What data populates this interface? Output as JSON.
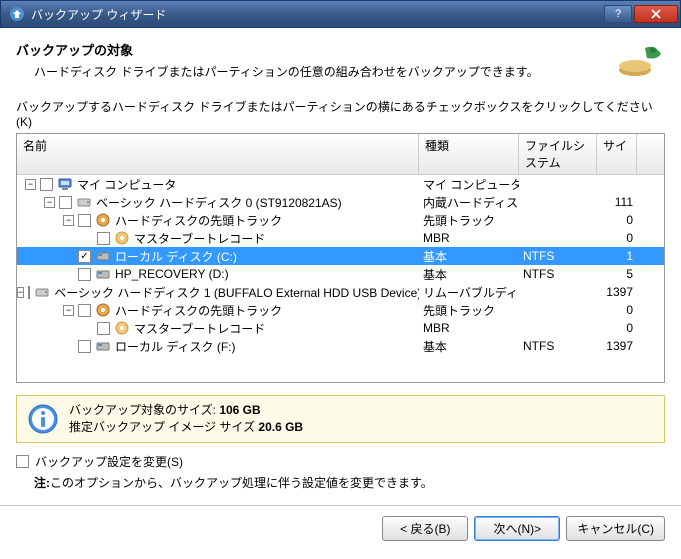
{
  "window": {
    "title": "バックアップ ウィザード"
  },
  "header": {
    "heading": "バックアップの対象",
    "sub": "ハードディスク ドライブまたはパーティションの任意の組み合わせをバックアップできます。"
  },
  "instruction": "バックアップするハードディスク ドライブまたはパーティションの横にあるチェックボックスをクリックしてください(K)",
  "columns": {
    "name": "名前",
    "type": "種類",
    "fs": "ファイルシステム",
    "size": "サイ"
  },
  "tree": [
    {
      "depth": 0,
      "expander": "-",
      "chk": false,
      "icon": "computer-icon",
      "label": "マイ コンピュータ",
      "type": "マイ コンピュータ",
      "fs": "",
      "size": ""
    },
    {
      "depth": 1,
      "expander": "-",
      "chk": false,
      "icon": "disk-icon",
      "label": "ベーシック ハードディスク 0 (ST9120821AS)",
      "type": "内蔵ハードディスク",
      "fs": "",
      "size": "111"
    },
    {
      "depth": 2,
      "expander": "-",
      "chk": false,
      "icon": "track-icon",
      "label": "ハードディスクの先頭トラック",
      "type": "先頭トラック",
      "fs": "",
      "size": "0"
    },
    {
      "depth": 3,
      "expander": "",
      "chk": false,
      "icon": "mbr-icon",
      "label": "マスターブートレコード",
      "type": "MBR",
      "fs": "",
      "size": "0"
    },
    {
      "depth": 2,
      "expander": "",
      "chk": true,
      "icon": "volume-icon",
      "label": "ローカル ディスク (C:)",
      "type": "基本",
      "fs": "NTFS",
      "size": "1",
      "selected": true
    },
    {
      "depth": 2,
      "expander": "",
      "chk": false,
      "icon": "volume-icon",
      "label": "HP_RECOVERY (D:)",
      "type": "基本",
      "fs": "NTFS",
      "size": "5"
    },
    {
      "depth": 1,
      "expander": "-",
      "chk": false,
      "icon": "disk-icon",
      "label": "ベーシック ハードディスク 1 (BUFFALO External HDD USB Device)",
      "type": "リムーバブルディスク",
      "fs": "",
      "size": "1397"
    },
    {
      "depth": 2,
      "expander": "-",
      "chk": false,
      "icon": "track-icon",
      "label": "ハードディスクの先頭トラック",
      "type": "先頭トラック",
      "fs": "",
      "size": "0"
    },
    {
      "depth": 3,
      "expander": "",
      "chk": false,
      "icon": "mbr-icon",
      "label": "マスターブートレコード",
      "type": "MBR",
      "fs": "",
      "size": "0"
    },
    {
      "depth": 2,
      "expander": "",
      "chk": false,
      "icon": "volume-icon",
      "label": "ローカル ディスク (F:)",
      "type": "基本",
      "fs": "NTFS",
      "size": "1397"
    }
  ],
  "info": {
    "line1_label": "バックアップ対象のサイズ: ",
    "line1_value": "106 GB",
    "line2_label": "推定バックアップ イメージ サイズ ",
    "line2_value": "20.6 GB"
  },
  "settings": {
    "label": "バックアップ設定を変更(S)",
    "note_prefix": "注:",
    "note_text": "このオプションから、バックアップ処理に伴う設定値を変更できます。"
  },
  "buttons": {
    "back": "< 戻る(B)",
    "next": "次へ(N)>",
    "cancel": "キャンセル(C)"
  }
}
